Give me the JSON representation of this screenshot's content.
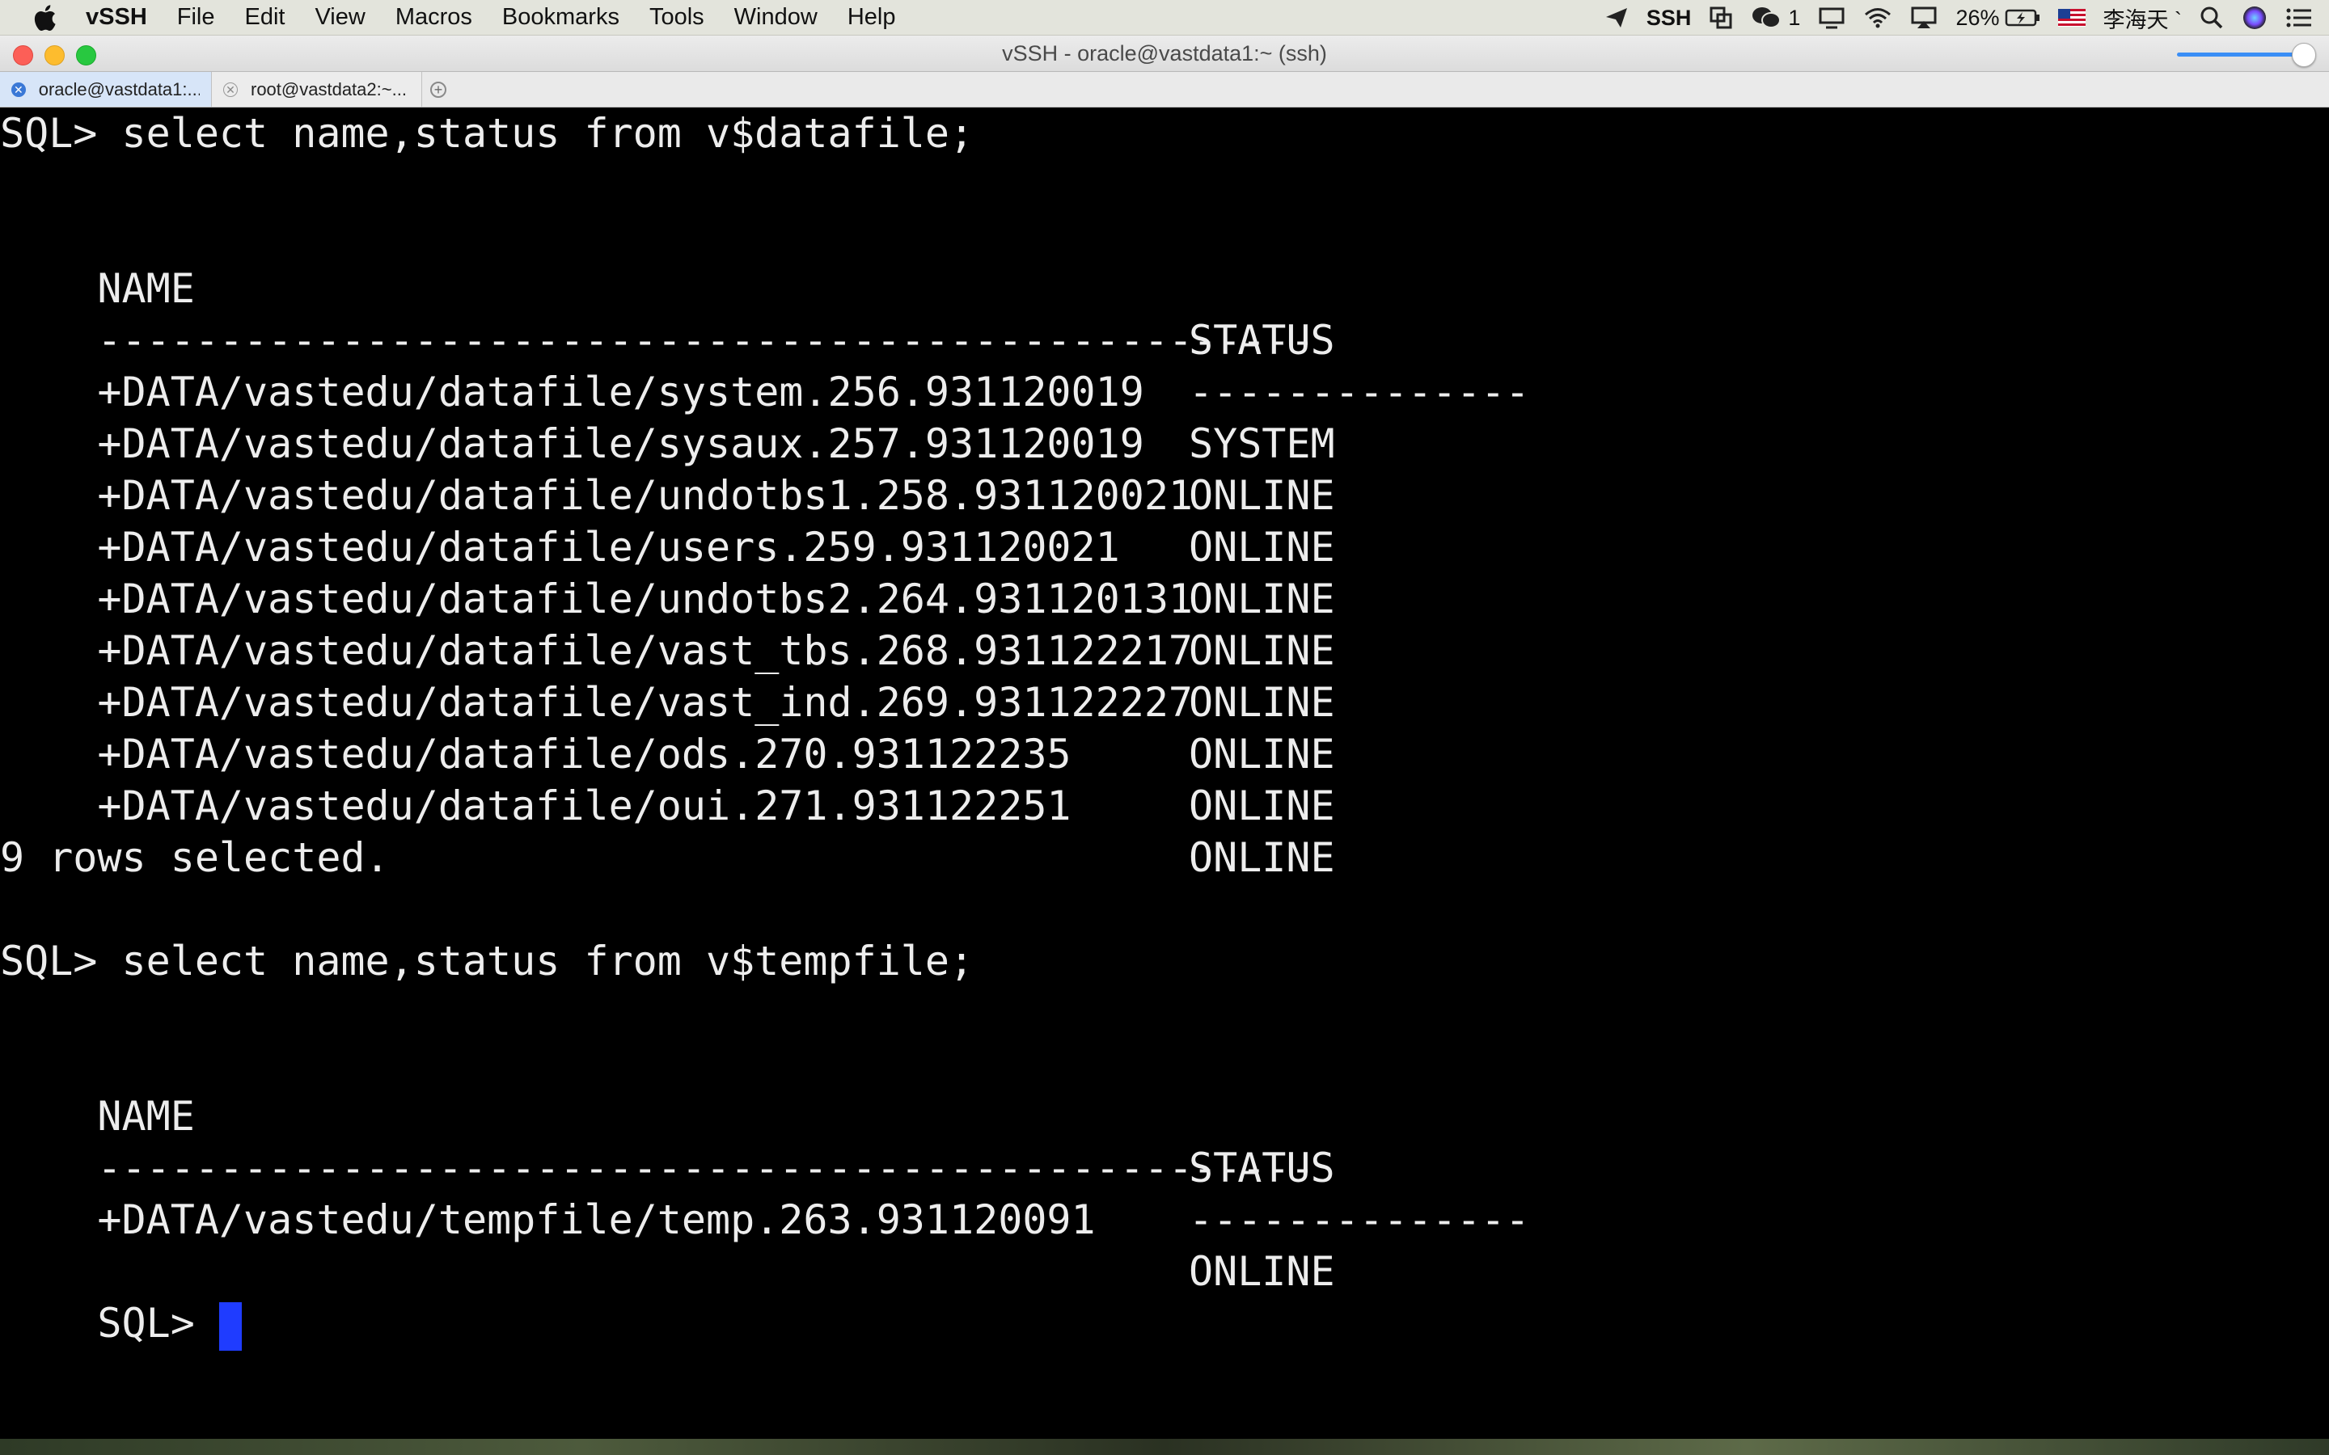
{
  "menubar": {
    "app_name": "vSSH",
    "items": [
      "File",
      "Edit",
      "View",
      "Macros",
      "Bookmarks",
      "Tools",
      "Window",
      "Help"
    ],
    "status": {
      "ssh_label": "SSH",
      "wechat_count": "1",
      "battery": "26%",
      "user_name": "李海天 `"
    }
  },
  "window": {
    "title": "vSSH - oracle@vastdata1:~ (ssh)"
  },
  "tabs": [
    {
      "label": "oracle@vastdata1:..."
    },
    {
      "label": "root@vastdata2:~..."
    }
  ],
  "terminal": {
    "cmd1": "SQL> select name,status from v$datafile;",
    "header_name": "NAME",
    "header_status": "STATUS",
    "dash_name": "--------------------------------------------------",
    "dash_status": "--------------",
    "datafiles": [
      {
        "name": "+DATA/vastedu/datafile/system.256.931120019",
        "status": "SYSTEM"
      },
      {
        "name": "+DATA/vastedu/datafile/sysaux.257.931120019",
        "status": "ONLINE"
      },
      {
        "name": "+DATA/vastedu/datafile/undotbs1.258.931120021",
        "status": "ONLINE"
      },
      {
        "name": "+DATA/vastedu/datafile/users.259.931120021",
        "status": "ONLINE"
      },
      {
        "name": "+DATA/vastedu/datafile/undotbs2.264.931120131",
        "status": "ONLINE"
      },
      {
        "name": "+DATA/vastedu/datafile/vast_tbs.268.931122217",
        "status": "ONLINE"
      },
      {
        "name": "+DATA/vastedu/datafile/vast_ind.269.931122227",
        "status": "ONLINE"
      },
      {
        "name": "+DATA/vastedu/datafile/ods.270.931122235",
        "status": "ONLINE"
      },
      {
        "name": "+DATA/vastedu/datafile/oui.271.931122251",
        "status": "ONLINE"
      }
    ],
    "rows_selected": "9 rows selected.",
    "cmd2": "SQL> select name,status from v$tempfile;",
    "tempfiles": [
      {
        "name": "+DATA/vastedu/tempfile/temp.263.931120091",
        "status": "ONLINE"
      }
    ],
    "prompt": "SQL> "
  },
  "colors": {
    "terminal_bg": "#000000",
    "terminal_fg": "#ededed",
    "cursor": "#1f3cff"
  }
}
